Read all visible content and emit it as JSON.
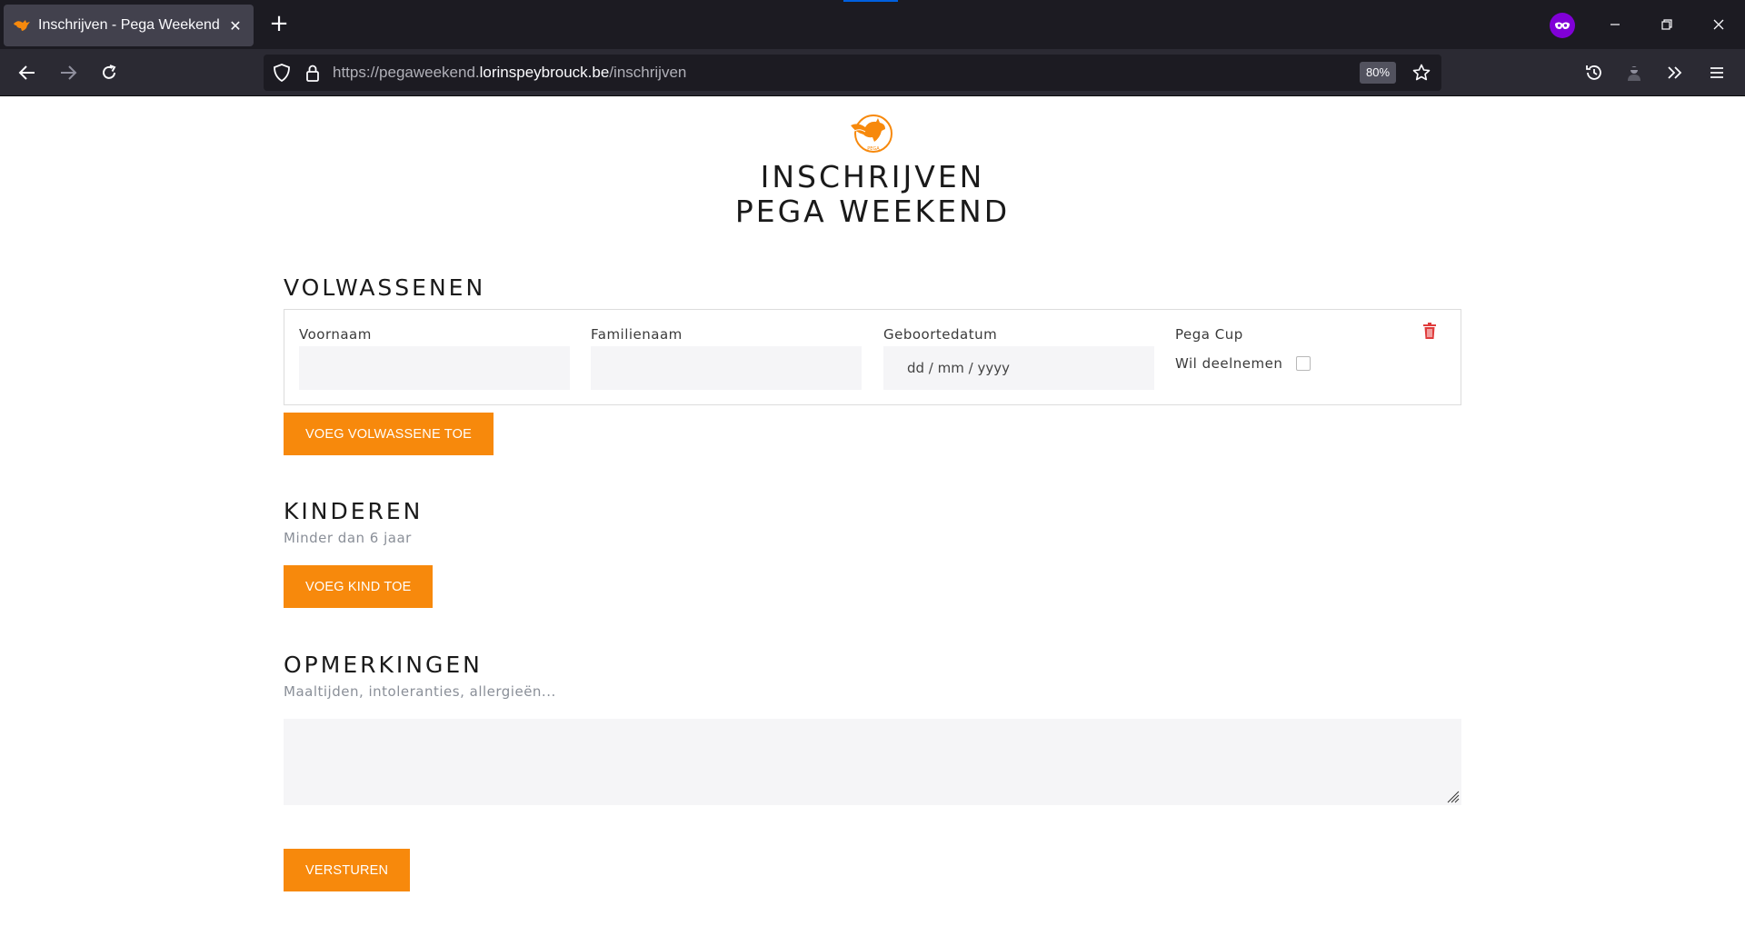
{
  "browser": {
    "tab_title": "Inschrijven - Pega Weekend",
    "tab_close": "✕",
    "new_tab": "+",
    "url_scheme": "https://",
    "url_sub": "pegaweekend.",
    "url_host": "lorinspeybrouck.be",
    "url_path": "/inschrijven",
    "zoom": "80%"
  },
  "header": {
    "title_line1": "INSCHRIJVEN",
    "title_line2": "PEGA WEEKEND",
    "logo_text": "PEGA"
  },
  "adults": {
    "title": "VOLWASSENEN",
    "first_name_label": "Voornaam",
    "last_name_label": "Familienaam",
    "birthdate_label": "Geboortedatum",
    "birthdate_placeholder": "dd / mm / yyyy",
    "cup_label": "Pega Cup",
    "cup_checkbox_label": "Wil deelnemen",
    "add_button": "VOEG VOLWASSENE TOE"
  },
  "children": {
    "title": "KINDEREN",
    "subtitle": "Minder dan 6 jaar",
    "add_button": "VOEG KIND TOE"
  },
  "remarks": {
    "title": "OPMERKINGEN",
    "subtitle": "Maaltijden, intoleranties, allergieën..."
  },
  "submit_button": "VERSTUREN",
  "colors": {
    "accent": "#f7890c",
    "delete": "#e03c3c",
    "private": "#8000d7"
  }
}
